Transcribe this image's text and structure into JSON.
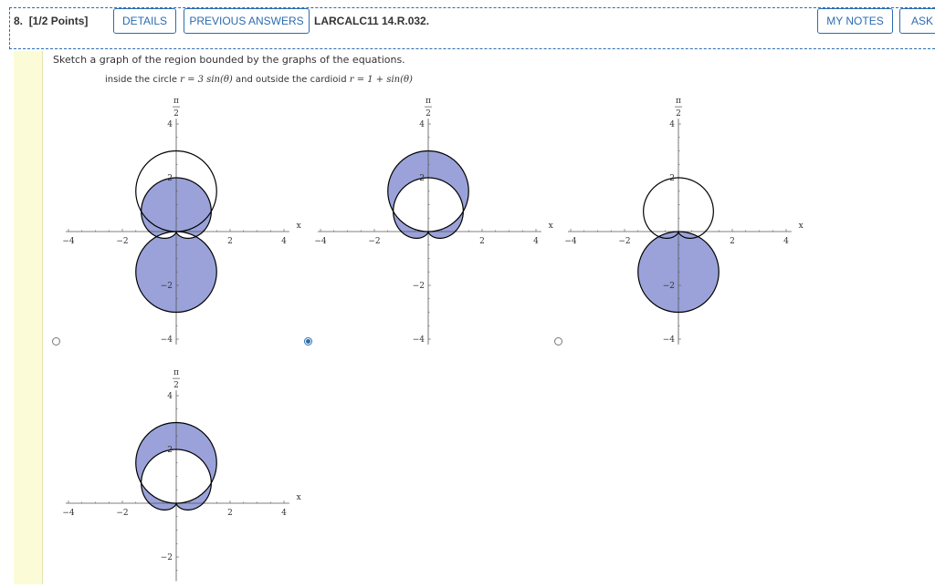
{
  "header": {
    "question_number": "8.",
    "points": "[1/2 Points]",
    "details_label": "DETAILS",
    "previous_answers_label": "PREVIOUS ANSWERS",
    "reference": "LARCALC11 14.R.032.",
    "my_notes_label": "MY NOTES",
    "ask_label": "ASK Y"
  },
  "question": {
    "prompt": "Sketch a graph of the region bounded by the graphs of the equations.",
    "subtitle_prefix": "inside the circle ",
    "circle_eq": "r = 3 sin(θ)",
    "subtitle_mid": " and outside the cardioid ",
    "cardioid_eq": "r = 1 + sin(θ)"
  },
  "colors": {
    "fill": "#9aa2d9",
    "accent": "#2b6cb0",
    "sidebar": "#fbfbd8"
  },
  "options": [
    {
      "id": "a",
      "selected": false,
      "shade": "outside-cardioid-inside-big-circle"
    },
    {
      "id": "b",
      "selected": true,
      "shade": "inside-circle-outside-cardioid"
    },
    {
      "id": "c",
      "selected": false,
      "shade": "lower-circle"
    },
    {
      "id": "d",
      "selected": false,
      "shade": "small-lobes"
    }
  ],
  "graph": {
    "pi_label": "π",
    "two_label": "2",
    "x_label": "x",
    "x_ticks": [
      "−4",
      "−2",
      "2",
      "4"
    ],
    "y_ticks_pos": [
      "4",
      "2"
    ],
    "y_ticks_neg": [
      "−2",
      "−4"
    ]
  }
}
